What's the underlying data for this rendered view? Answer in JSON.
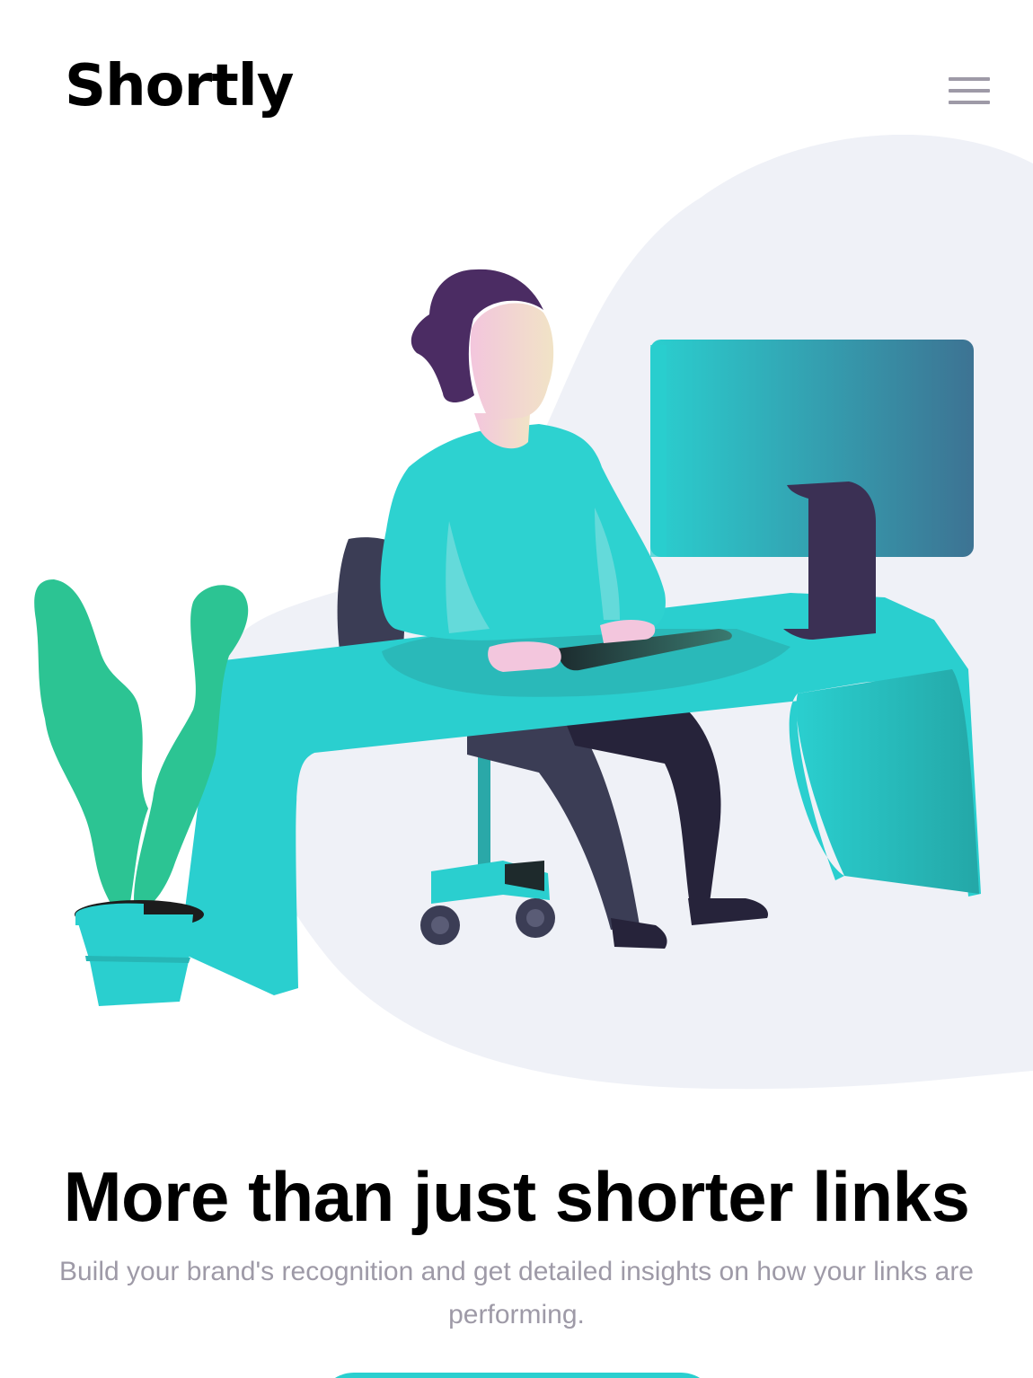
{
  "header": {
    "logo": "Shortly",
    "menu_icon": "hamburger-menu-icon"
  },
  "hero": {
    "illustration": "person-working-at-desk-illustration",
    "title": "More than just shorter links",
    "subtitle": "Build your brand's recognition and get detailed insights on how your links are performing."
  },
  "colors": {
    "primary": "#2acfcf",
    "secondary": "#3b3054",
    "text_gray": "#9e9aa7",
    "background_blob": "#eff1f7"
  }
}
